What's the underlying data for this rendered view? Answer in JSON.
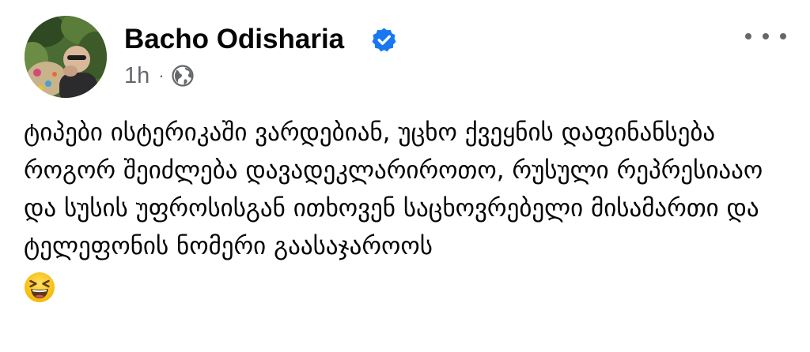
{
  "post": {
    "author": {
      "name": "Bacho Odisharia",
      "verified": true,
      "avatar": "profile-photo"
    },
    "timestamp": "1h",
    "separator": "·",
    "audience_icon": "globe-icon",
    "more_icon": "more-options-icon",
    "text": "ტიპები ისტერიკაში ვარდებიან, უცხო ქვეყნის დაფინანსება როგორ შეიძლება დავადეკლარიროთო, რუსული რეპრესიააო და სუსის უფროსისგან ითხოვენ საცხოვრებელი მისამართი და ტელეფონის ნომერი გაასაჯაროოს",
    "emoji": "laughing-face-emoji"
  },
  "colors": {
    "text": "#050505",
    "secondary": "#65676b",
    "verified_blue": "#1877f2",
    "emoji_yellow": "#ffcc33"
  }
}
